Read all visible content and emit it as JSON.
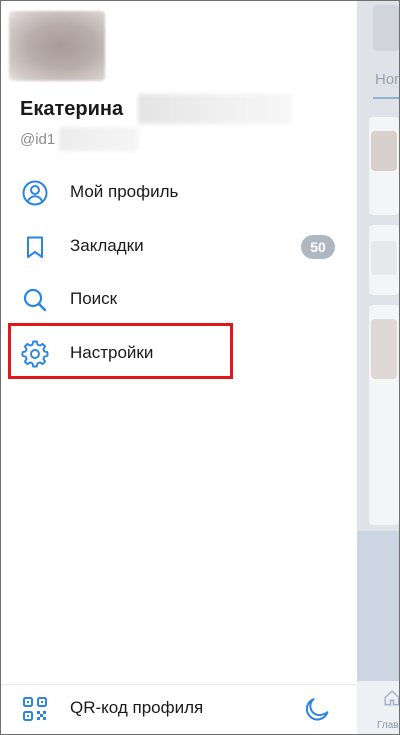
{
  "user": {
    "name": "Екатерина",
    "handle": "@id1"
  },
  "menu": [
    {
      "label": "Мой профиль",
      "icon": "user-circle-icon"
    },
    {
      "label": "Закладки",
      "icon": "bookmark-icon",
      "badge": "50"
    },
    {
      "label": "Поиск",
      "icon": "search-icon"
    },
    {
      "label": "Настройки",
      "icon": "gear-icon"
    }
  ],
  "bottom": {
    "qr_label": "QR-код профиля",
    "qr_icon": "qr-code-icon",
    "theme_icon": "moon-icon"
  },
  "background_app": {
    "tab_label": "Hon",
    "bottom_label": "Глав"
  },
  "colors": {
    "accent": "#2a84e0",
    "highlight": "#e0181b",
    "badge": "#aeb8c3"
  }
}
